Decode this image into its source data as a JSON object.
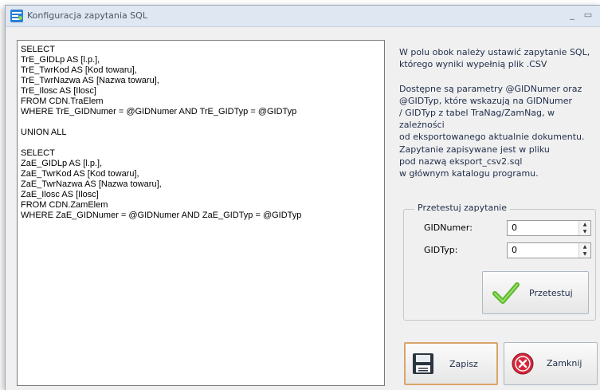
{
  "window": {
    "title": "Konfiguracja zapytania SQL",
    "minimize_glyph": "_",
    "maximize_glyph": "▭",
    "close_glyph": "×"
  },
  "sql_query": [
    "SELECT",
    "TrE_GIDLp AS [l.p.],",
    "TrE_TwrKod AS [Kod towaru],",
    "TrE_TwrNazwa AS [Nazwa towaru],",
    "TrE_Ilosc AS [Ilosc]",
    "FROM CDN.TraElem",
    "WHERE TrE_GIDNumer = @GIDNumer AND TrE_GIDTyp = @GIDTyp",
    "",
    "UNION ALL",
    "",
    "SELECT",
    "ZaE_GIDLp AS [l.p.],",
    "ZaE_TwrKod AS [Kod towaru],",
    "ZaE_TwrNazwa AS [Nazwa towaru],",
    "ZaE_Ilosc AS [Ilosc]",
    "FROM CDN.ZamElem",
    "WHERE ZaE_GIDNumer = @GIDNumer AND ZaE_GIDTyp = @GIDTyp"
  ],
  "description": {
    "para1": [
      "W polu obok należy ustawić zapytanie SQL,",
      "którego wyniki wypełnią plik .CSV"
    ],
    "para2": [
      "Dostępne są parametry @GIDNumer oraz",
      "@GIDTyp, które wskazują na GIDNumer",
      "/ GIDTyp z tabel TraNag/ZamNag, w zależności",
      "od eksportowanego aktualnie dokumentu."
    ],
    "para3": [
      "Zapytanie zapisywane jest w pliku",
      "pod nazwą eksport_csv2.sql",
      "w głównym katalogu programu."
    ]
  },
  "test_group": {
    "title": "Przetestuj zapytanie",
    "gidnumer_label": "GIDNumer:",
    "gidnumer_value": "0",
    "gidtyp_label": "GIDTyp:",
    "gidtyp_value": "0",
    "test_button_label": "Przetestuj"
  },
  "buttons": {
    "save_label": "Zapisz",
    "close_label": "Zamknij"
  },
  "colors": {
    "accent_green": "#5cb82c",
    "close_red": "#d6283c",
    "focus_border": "#d9a46b"
  },
  "icons": {
    "app": "sql-config-icon",
    "test": "checkmark-icon",
    "save": "floppy-disk-icon",
    "close": "red-x-circle-icon"
  }
}
